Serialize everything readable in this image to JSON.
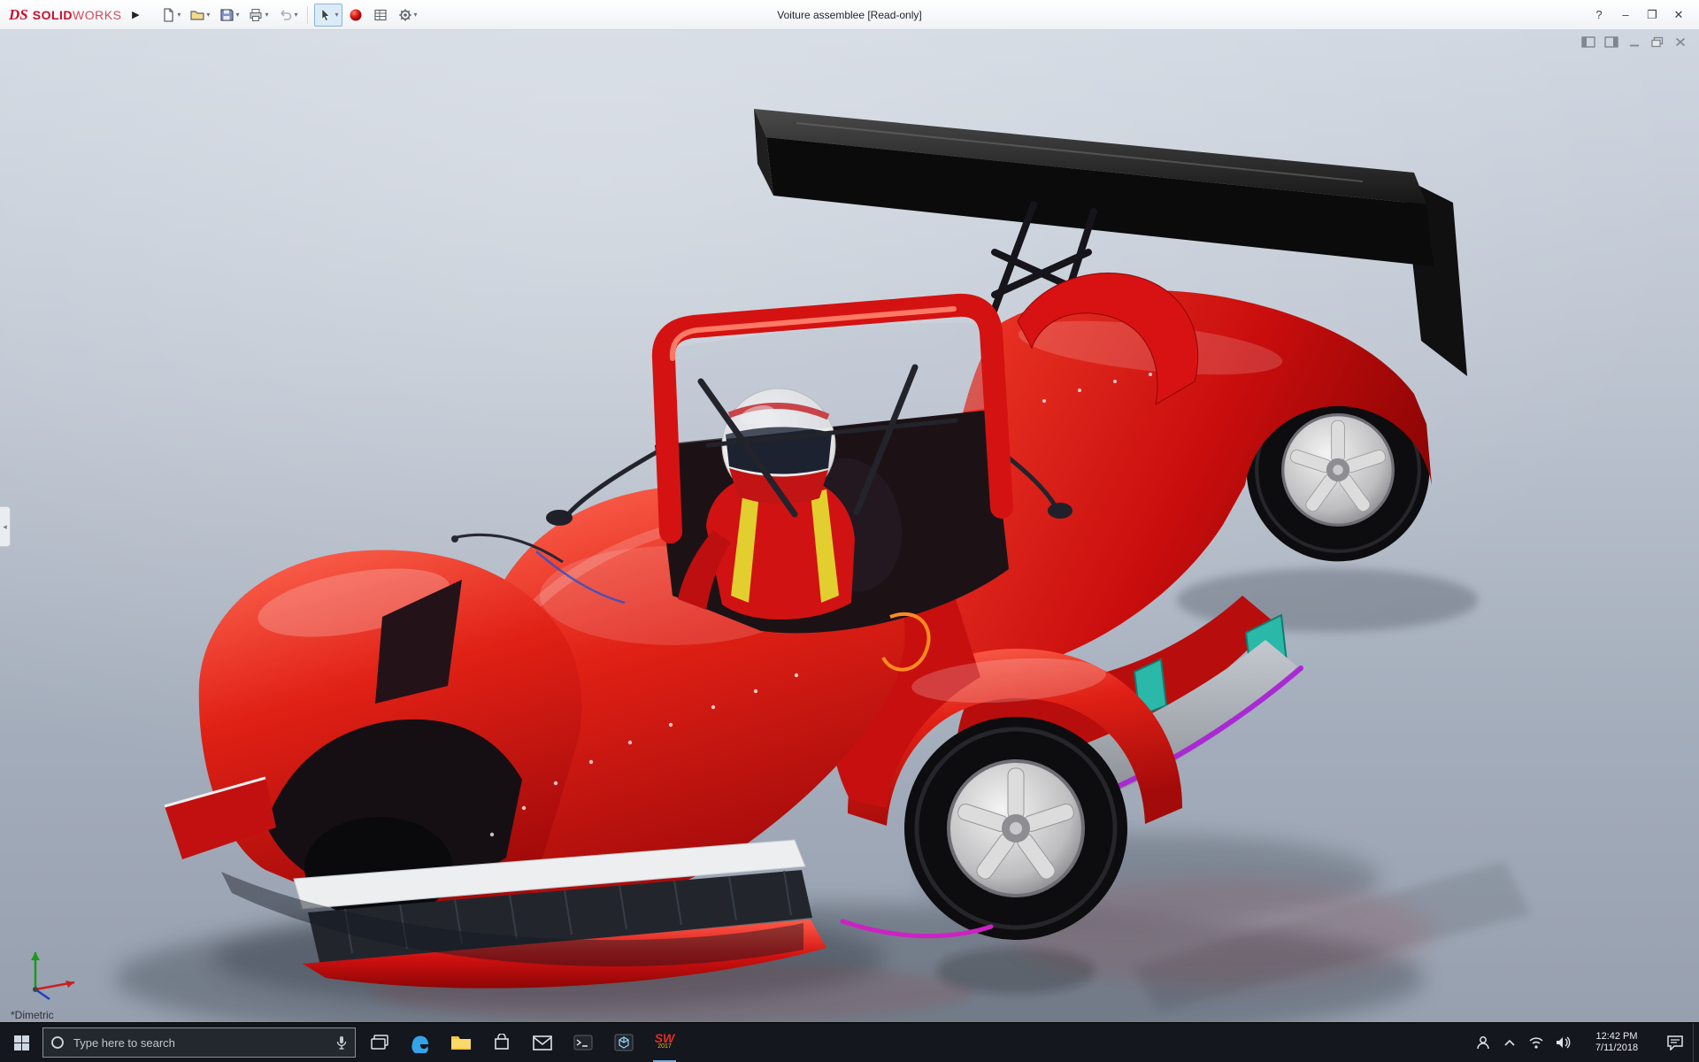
{
  "titlebar": {
    "brand": {
      "mark": "DS",
      "solid": "SOLID",
      "works": "WORKS"
    },
    "menu_expand": "▶",
    "title": "Voiture assemblee [Read-only]",
    "dropdown_glyph": "▾",
    "help_glyph": "?",
    "minimize_glyph": "–",
    "maximize_glyph": "❐",
    "close_glyph": "✕"
  },
  "viewport": {
    "orientation_label": "*Dimetric"
  },
  "taskbar": {
    "search_placeholder": "Type here to search",
    "solidworks": {
      "label": "SW",
      "year": "2017"
    },
    "tray": {
      "time": "12:42 PM",
      "date": "7/11/2018"
    }
  },
  "colors": {
    "brand_red": "#c8102e",
    "car_red": "#d81414",
    "taskbar_bg": "#14171d",
    "viewport_top": "#cfd6e0",
    "viewport_bottom": "#97a0af"
  }
}
